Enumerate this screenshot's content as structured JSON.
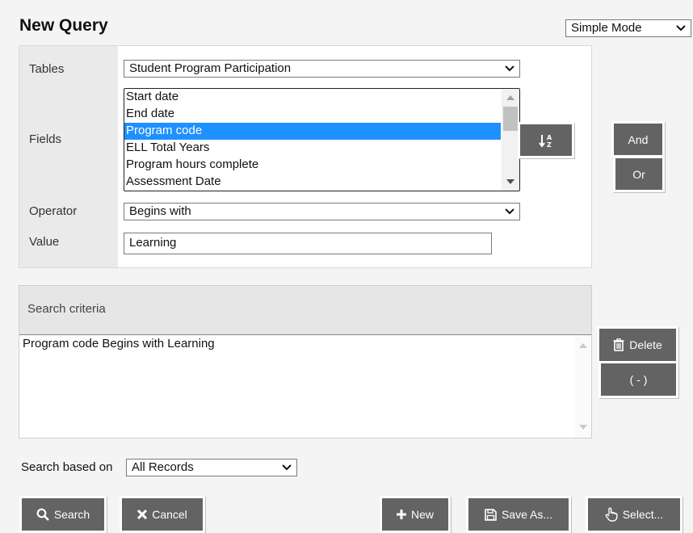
{
  "header": {
    "title": "New Query"
  },
  "mode": {
    "selected": "Simple Mode"
  },
  "form": {
    "tables_label": "Tables",
    "tables_value": "Student Program Participation",
    "fields_label": "Fields",
    "fields": [
      {
        "label": "Start date",
        "selected": false
      },
      {
        "label": "End date",
        "selected": false
      },
      {
        "label": "Program code",
        "selected": true
      },
      {
        "label": "ELL Total Years",
        "selected": false
      },
      {
        "label": "Program hours complete",
        "selected": false
      },
      {
        "label": "Assessment Date",
        "selected": false
      }
    ],
    "operator_label": "Operator",
    "operator_value": "Begins with",
    "value_label": "Value",
    "value_value": "Learning"
  },
  "logic": {
    "and_label": "And",
    "or_label": "Or"
  },
  "criteria": {
    "header": "Search criteria",
    "text": "Program code Begins with Learning",
    "delete_label": "Delete",
    "paren_label": "( - )"
  },
  "search_based": {
    "label": "Search based on",
    "value": "All Records"
  },
  "footer": {
    "search_label": "Search",
    "cancel_label": "Cancel",
    "new_label": "New",
    "saveas_label": "Save As...",
    "select_label": "Select..."
  },
  "colors": {
    "button_bg": "#636363",
    "selection": "#1e90ff"
  },
  "icons": {
    "sort": "sort-az-icon",
    "delete": "trash-icon",
    "search": "magnifier-icon",
    "cancel": "x-icon",
    "new": "plus-icon",
    "saveas": "floppy-disk-icon",
    "select": "hand-pointer-icon"
  }
}
